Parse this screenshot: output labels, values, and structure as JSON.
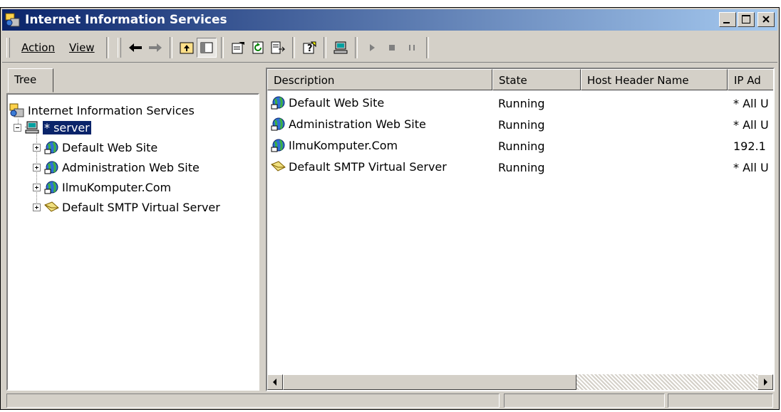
{
  "window": {
    "title": "Internet Information Services"
  },
  "menu": {
    "action": "Action",
    "view": "View"
  },
  "toolbar_icons": [
    "back-arrow-icon",
    "forward-arrow-icon",
    "up-folder-icon",
    "show-hide-tree-icon",
    "properties-icon",
    "refresh-icon",
    "export-list-icon",
    "help-icon",
    "computer-icon",
    "start-icon",
    "stop-icon",
    "pause-icon"
  ],
  "left_pane": {
    "tab_label": "Tree",
    "root": "Internet Information Services",
    "server": "* server",
    "children": [
      "Default Web Site",
      "Administration Web Site",
      "IlmuKomputer.Com",
      "Default SMTP Virtual Server"
    ]
  },
  "list": {
    "columns": [
      "Description",
      "State",
      "Host Header Name",
      "IP Ad"
    ],
    "rows": [
      {
        "description": "Default Web Site",
        "state": "Running",
        "host": "",
        "ip": "* All U",
        "icon": "globe-icon"
      },
      {
        "description": "Administration Web Site",
        "state": "Running",
        "host": "",
        "ip": "* All U",
        "icon": "globe-icon"
      },
      {
        "description": "IlmuKomputer.Com",
        "state": "Running",
        "host": "",
        "ip": "192.1",
        "icon": "globe-icon"
      },
      {
        "description": "Default SMTP Virtual Server",
        "state": "Running",
        "host": "",
        "ip": "* All U",
        "icon": "envelope-icon"
      }
    ]
  },
  "colors": {
    "titlebar_start": "#0a246a",
    "titlebar_end": "#a6caf0",
    "face": "#d4d0c8",
    "selection": "#0a246a"
  }
}
